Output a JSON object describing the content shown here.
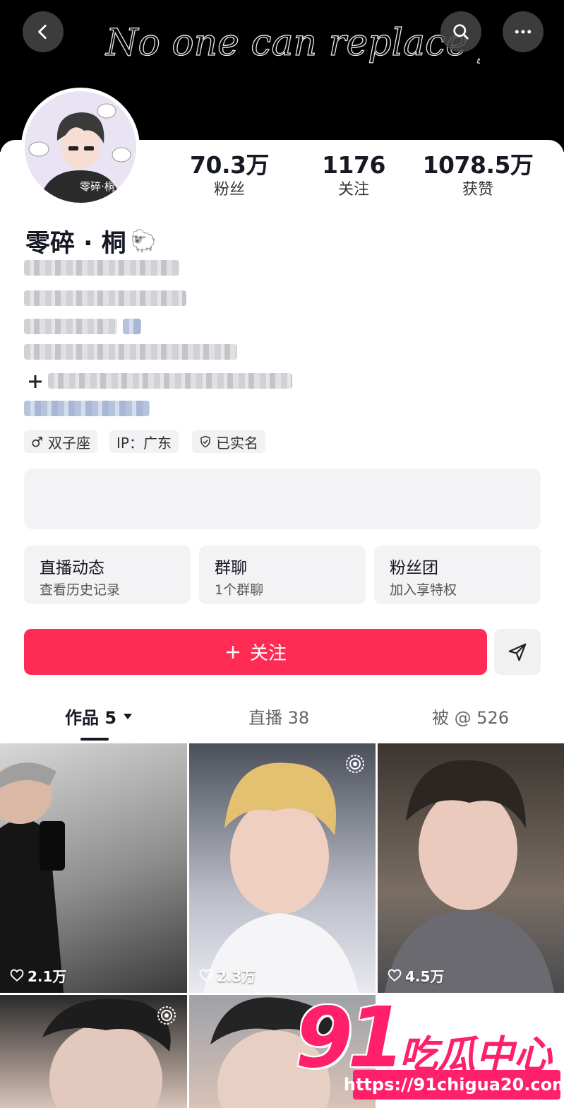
{
  "banner": {
    "script_text": "No one can replace you"
  },
  "profile": {
    "name": "零碎 · 桐",
    "name_emoji": "🐑",
    "avatar_caption": "零碎·桐",
    "stats": [
      {
        "value": "70.3万",
        "label": "粉丝"
      },
      {
        "value": "1176",
        "label": "关注"
      },
      {
        "value": "1078.5万",
        "label": "获赞"
      }
    ],
    "tags": [
      {
        "icon": "male-icon",
        "text": "双子座"
      },
      {
        "icon": "",
        "text": "IP：广东"
      },
      {
        "icon": "shield-check-icon",
        "text": "已实名"
      }
    ]
  },
  "feature_cards": [
    {
      "title": "直播动态",
      "subtitle": "查看历史记录"
    },
    {
      "title": "群聊",
      "subtitle": "1个群聊"
    },
    {
      "title": "粉丝团",
      "subtitle": "加入享特权"
    }
  ],
  "actions": {
    "follow_label": "关注",
    "follow_icon": "plus-icon",
    "share_icon": "send-icon"
  },
  "tabs": [
    {
      "label": "作品 5",
      "active": true,
      "dropdown": true
    },
    {
      "label": "直播 38",
      "active": false
    },
    {
      "label": "被 @ 526",
      "active": false
    }
  ],
  "grid": [
    {
      "likes": "2.1万",
      "live": false
    },
    {
      "likes": "2.3万",
      "live": true
    },
    {
      "likes": "4.5万",
      "live": false
    },
    {
      "likes": "",
      "live": true
    },
    {
      "likes": "",
      "live": false
    }
  ],
  "watermark": {
    "number": "91",
    "title": "吃瓜中心",
    "url": "https://91chigua20.com"
  },
  "colors": {
    "accent": "#fe2c55",
    "watermark": "#ff1f6b"
  }
}
